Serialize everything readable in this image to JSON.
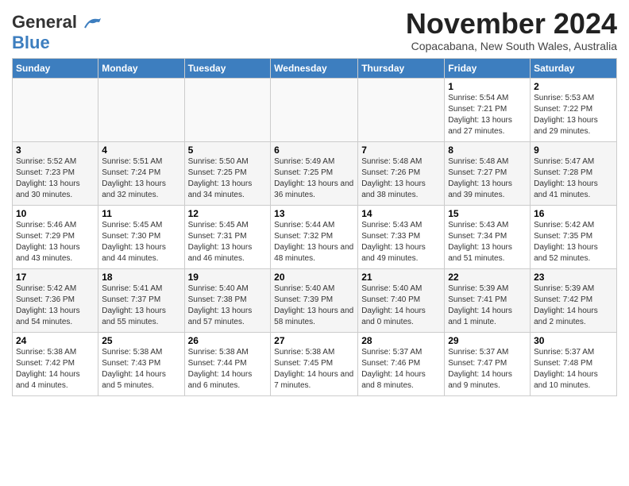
{
  "header": {
    "logo_general": "General",
    "logo_blue": "Blue",
    "month_title": "November 2024",
    "location": "Copacabana, New South Wales, Australia"
  },
  "weekdays": [
    "Sunday",
    "Monday",
    "Tuesday",
    "Wednesday",
    "Thursday",
    "Friday",
    "Saturday"
  ],
  "weeks": [
    [
      {
        "day": "",
        "sunrise": "",
        "sunset": "",
        "daylight": ""
      },
      {
        "day": "",
        "sunrise": "",
        "sunset": "",
        "daylight": ""
      },
      {
        "day": "",
        "sunrise": "",
        "sunset": "",
        "daylight": ""
      },
      {
        "day": "",
        "sunrise": "",
        "sunset": "",
        "daylight": ""
      },
      {
        "day": "",
        "sunrise": "",
        "sunset": "",
        "daylight": ""
      },
      {
        "day": "1",
        "sunrise": "Sunrise: 5:54 AM",
        "sunset": "Sunset: 7:21 PM",
        "daylight": "Daylight: 13 hours and 27 minutes."
      },
      {
        "day": "2",
        "sunrise": "Sunrise: 5:53 AM",
        "sunset": "Sunset: 7:22 PM",
        "daylight": "Daylight: 13 hours and 29 minutes."
      }
    ],
    [
      {
        "day": "3",
        "sunrise": "Sunrise: 5:52 AM",
        "sunset": "Sunset: 7:23 PM",
        "daylight": "Daylight: 13 hours and 30 minutes."
      },
      {
        "day": "4",
        "sunrise": "Sunrise: 5:51 AM",
        "sunset": "Sunset: 7:24 PM",
        "daylight": "Daylight: 13 hours and 32 minutes."
      },
      {
        "day": "5",
        "sunrise": "Sunrise: 5:50 AM",
        "sunset": "Sunset: 7:25 PM",
        "daylight": "Daylight: 13 hours and 34 minutes."
      },
      {
        "day": "6",
        "sunrise": "Sunrise: 5:49 AM",
        "sunset": "Sunset: 7:25 PM",
        "daylight": "Daylight: 13 hours and 36 minutes."
      },
      {
        "day": "7",
        "sunrise": "Sunrise: 5:48 AM",
        "sunset": "Sunset: 7:26 PM",
        "daylight": "Daylight: 13 hours and 38 minutes."
      },
      {
        "day": "8",
        "sunrise": "Sunrise: 5:48 AM",
        "sunset": "Sunset: 7:27 PM",
        "daylight": "Daylight: 13 hours and 39 minutes."
      },
      {
        "day": "9",
        "sunrise": "Sunrise: 5:47 AM",
        "sunset": "Sunset: 7:28 PM",
        "daylight": "Daylight: 13 hours and 41 minutes."
      }
    ],
    [
      {
        "day": "10",
        "sunrise": "Sunrise: 5:46 AM",
        "sunset": "Sunset: 7:29 PM",
        "daylight": "Daylight: 13 hours and 43 minutes."
      },
      {
        "day": "11",
        "sunrise": "Sunrise: 5:45 AM",
        "sunset": "Sunset: 7:30 PM",
        "daylight": "Daylight: 13 hours and 44 minutes."
      },
      {
        "day": "12",
        "sunrise": "Sunrise: 5:45 AM",
        "sunset": "Sunset: 7:31 PM",
        "daylight": "Daylight: 13 hours and 46 minutes."
      },
      {
        "day": "13",
        "sunrise": "Sunrise: 5:44 AM",
        "sunset": "Sunset: 7:32 PM",
        "daylight": "Daylight: 13 hours and 48 minutes."
      },
      {
        "day": "14",
        "sunrise": "Sunrise: 5:43 AM",
        "sunset": "Sunset: 7:33 PM",
        "daylight": "Daylight: 13 hours and 49 minutes."
      },
      {
        "day": "15",
        "sunrise": "Sunrise: 5:43 AM",
        "sunset": "Sunset: 7:34 PM",
        "daylight": "Daylight: 13 hours and 51 minutes."
      },
      {
        "day": "16",
        "sunrise": "Sunrise: 5:42 AM",
        "sunset": "Sunset: 7:35 PM",
        "daylight": "Daylight: 13 hours and 52 minutes."
      }
    ],
    [
      {
        "day": "17",
        "sunrise": "Sunrise: 5:42 AM",
        "sunset": "Sunset: 7:36 PM",
        "daylight": "Daylight: 13 hours and 54 minutes."
      },
      {
        "day": "18",
        "sunrise": "Sunrise: 5:41 AM",
        "sunset": "Sunset: 7:37 PM",
        "daylight": "Daylight: 13 hours and 55 minutes."
      },
      {
        "day": "19",
        "sunrise": "Sunrise: 5:40 AM",
        "sunset": "Sunset: 7:38 PM",
        "daylight": "Daylight: 13 hours and 57 minutes."
      },
      {
        "day": "20",
        "sunrise": "Sunrise: 5:40 AM",
        "sunset": "Sunset: 7:39 PM",
        "daylight": "Daylight: 13 hours and 58 minutes."
      },
      {
        "day": "21",
        "sunrise": "Sunrise: 5:40 AM",
        "sunset": "Sunset: 7:40 PM",
        "daylight": "Daylight: 14 hours and 0 minutes."
      },
      {
        "day": "22",
        "sunrise": "Sunrise: 5:39 AM",
        "sunset": "Sunset: 7:41 PM",
        "daylight": "Daylight: 14 hours and 1 minute."
      },
      {
        "day": "23",
        "sunrise": "Sunrise: 5:39 AM",
        "sunset": "Sunset: 7:42 PM",
        "daylight": "Daylight: 14 hours and 2 minutes."
      }
    ],
    [
      {
        "day": "24",
        "sunrise": "Sunrise: 5:38 AM",
        "sunset": "Sunset: 7:42 PM",
        "daylight": "Daylight: 14 hours and 4 minutes."
      },
      {
        "day": "25",
        "sunrise": "Sunrise: 5:38 AM",
        "sunset": "Sunset: 7:43 PM",
        "daylight": "Daylight: 14 hours and 5 minutes."
      },
      {
        "day": "26",
        "sunrise": "Sunrise: 5:38 AM",
        "sunset": "Sunset: 7:44 PM",
        "daylight": "Daylight: 14 hours and 6 minutes."
      },
      {
        "day": "27",
        "sunrise": "Sunrise: 5:38 AM",
        "sunset": "Sunset: 7:45 PM",
        "daylight": "Daylight: 14 hours and 7 minutes."
      },
      {
        "day": "28",
        "sunrise": "Sunrise: 5:37 AM",
        "sunset": "Sunset: 7:46 PM",
        "daylight": "Daylight: 14 hours and 8 minutes."
      },
      {
        "day": "29",
        "sunrise": "Sunrise: 5:37 AM",
        "sunset": "Sunset: 7:47 PM",
        "daylight": "Daylight: 14 hours and 9 minutes."
      },
      {
        "day": "30",
        "sunrise": "Sunrise: 5:37 AM",
        "sunset": "Sunset: 7:48 PM",
        "daylight": "Daylight: 14 hours and 10 minutes."
      }
    ]
  ]
}
